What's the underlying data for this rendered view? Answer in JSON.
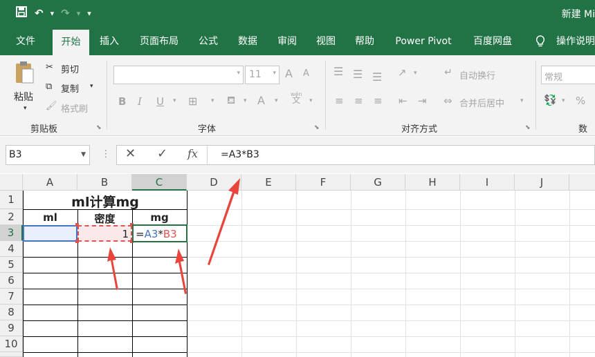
{
  "window": {
    "title": "新建 Mi"
  },
  "qat": {
    "undo_caret": "▾",
    "redo_caret": "▾",
    "customize": "▾"
  },
  "tabs": [
    "文件",
    "开始",
    "插入",
    "页面布局",
    "公式",
    "数据",
    "审阅",
    "视图",
    "帮助",
    "Power Pivot",
    "百度网盘",
    "操作说明"
  ],
  "active_tab": "开始",
  "ribbon": {
    "clipboard": {
      "paste": "粘贴",
      "cut": "剪切",
      "copy": "复制",
      "format_painter": "格式刷",
      "label": "剪贴板"
    },
    "font": {
      "size": "11",
      "bold": "B",
      "italic": "I",
      "underline": "U",
      "font_color": "A",
      "wen": "wén",
      "wen_char": "文",
      "inc": "A",
      "dec": "A",
      "label": "字体"
    },
    "alignment": {
      "wrap_text": "自动换行",
      "merge_center": "合并后居中",
      "label": "对齐方式"
    },
    "number": {
      "format": "常规",
      "percent": "%",
      "label": "数字"
    }
  },
  "formula_bar": {
    "name_box": "B3",
    "fx": "fx",
    "formula": "=A3*B3"
  },
  "grid": {
    "columns": [
      "A",
      "B",
      "C",
      "D",
      "E",
      "F",
      "G",
      "H",
      "I",
      "J"
    ],
    "rows": [
      "1",
      "2",
      "3",
      "4",
      "5",
      "6",
      "7",
      "8",
      "9",
      "10"
    ],
    "cells": {
      "A1": "ml计算mg",
      "A2": "ml",
      "B2": "密度",
      "C2": "mg",
      "B3": "1",
      "C3_eq": "=",
      "C3_ref1": "A3",
      "C3_op": "*",
      "C3_ref2": "B3"
    }
  },
  "colors": {
    "brand": "#217346",
    "ref_a3": "#4472c4",
    "ref_b3": "#e05252",
    "arrow": "#e8453c"
  }
}
